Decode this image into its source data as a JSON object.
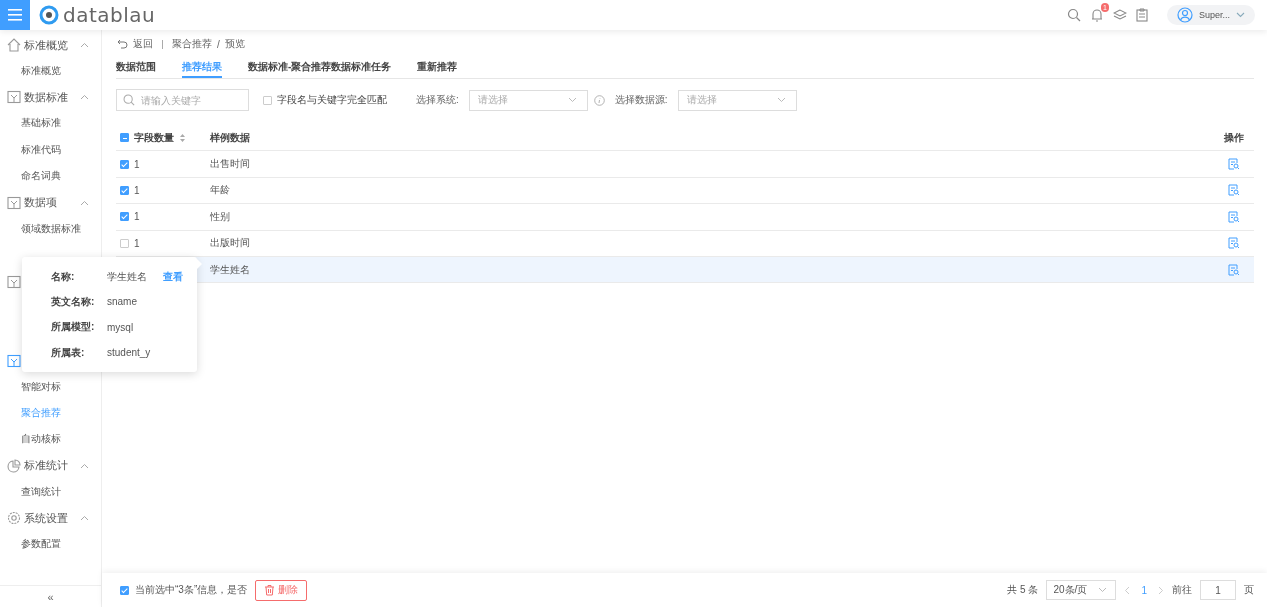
{
  "header": {
    "logo": "datablau",
    "notifications": "1",
    "user": "Super..."
  },
  "sidebar": {
    "groups": [
      {
        "title": "标准概览",
        "kind": "house",
        "active": false,
        "expanded": true,
        "items": [
          {
            "label": "标准概览",
            "selected": false
          }
        ]
      },
      {
        "title": "数据标准",
        "kind": "doc",
        "active": false,
        "expanded": true,
        "items": [
          {
            "label": "基础标准",
            "selected": false
          },
          {
            "label": "标准代码",
            "selected": false
          },
          {
            "label": "命名词典",
            "selected": false
          }
        ]
      },
      {
        "title": "数据项",
        "kind": "doc",
        "active": false,
        "expanded": true,
        "items": [
          {
            "label": "领域数据标准",
            "selected": false
          }
        ]
      },
      {
        "kind": "doc",
        "active": false
      },
      {
        "kind": "doc",
        "active": true,
        "items": [
          {
            "label": "智能对标",
            "selected": false
          },
          {
            "label": "聚合推荐",
            "selected": true
          },
          {
            "label": "自动核标",
            "selected": false
          }
        ]
      },
      {
        "title": "标准统计",
        "kind": "chart",
        "active": false,
        "expanded": true,
        "items": [
          {
            "label": "查询统计",
            "selected": false
          }
        ]
      },
      {
        "title": "系统设置",
        "kind": "gear",
        "active": false,
        "expanded": true,
        "items": [
          {
            "label": "参数配置",
            "selected": false
          }
        ]
      }
    ],
    "collapse": "«"
  },
  "breadcrumb": {
    "back": "返回",
    "path": [
      "聚合推荐",
      "预览"
    ],
    "separator": "/"
  },
  "tabs": [
    {
      "label": "数据范围",
      "selected": false
    },
    {
      "label": "推荐结果",
      "selected": true
    },
    {
      "label": "数据标准-聚合推荐数据标准任务",
      "selected": false
    },
    {
      "label": "重新推荐",
      "selected": false
    }
  ],
  "filters": {
    "search": {
      "placeholder": "请输入关键字"
    },
    "exact_match": {
      "label": "字段名与关键字完全匹配",
      "checked": false
    },
    "system": {
      "label": "选择系统:",
      "placeholder": "请选择"
    },
    "source": {
      "label": "选择数据源:",
      "placeholder": "请选择"
    }
  },
  "table": {
    "columns": [
      "字段数量",
      "样例数据",
      "操作"
    ],
    "header_checkbox": {
      "checked": true,
      "indeterminate": true
    },
    "rows": [
      {
        "checked": true,
        "count": "1",
        "sample": "出售时间",
        "selected": false
      },
      {
        "checked": true,
        "count": "1",
        "sample": "年龄",
        "selected": false
      },
      {
        "checked": true,
        "count": "1",
        "sample": "性别",
        "selected": false
      },
      {
        "checked": false,
        "count": "1",
        "sample": "出版时间",
        "selected": false
      },
      {
        "sample": "学生姓名",
        "selected": true
      }
    ]
  },
  "popover": {
    "rows": [
      {
        "label": "名称:",
        "value": "学生姓名",
        "link": "查看"
      },
      {
        "label": "英文名称:",
        "value": "sname"
      },
      {
        "label": "所属模型:",
        "value": "mysql"
      },
      {
        "label": "所属表:",
        "value": "student_y"
      }
    ]
  },
  "footer": {
    "checked": true,
    "message": "当前选中“3条”信息，是否",
    "delete": "删除",
    "total": "共 5 条",
    "page_size": "20条/页",
    "pages": [
      {
        "label": "1",
        "selected": true
      }
    ],
    "goto": "前往",
    "page_input": "1",
    "page_unit": "页"
  }
}
